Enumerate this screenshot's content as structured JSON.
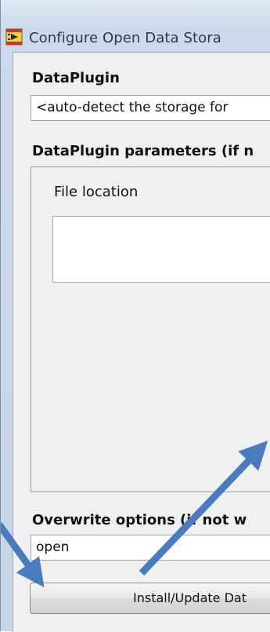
{
  "window": {
    "title": "Configure Open Data Stora",
    "icon": "labview-vi-icon"
  },
  "dataplugin": {
    "label": "DataPlugin",
    "value": "<auto-detect the storage for"
  },
  "parameters": {
    "label": "DataPlugin parameters (if n",
    "file_location_label": "File location",
    "file_location_value": ""
  },
  "overwrite": {
    "label": "Overwrite options (if not w",
    "value": "open"
  },
  "install_button": {
    "label": "Install/Update Dat"
  },
  "colors": {
    "annotation_arrow": "#4a7bbf",
    "panel_background": "#f0f0f0"
  }
}
